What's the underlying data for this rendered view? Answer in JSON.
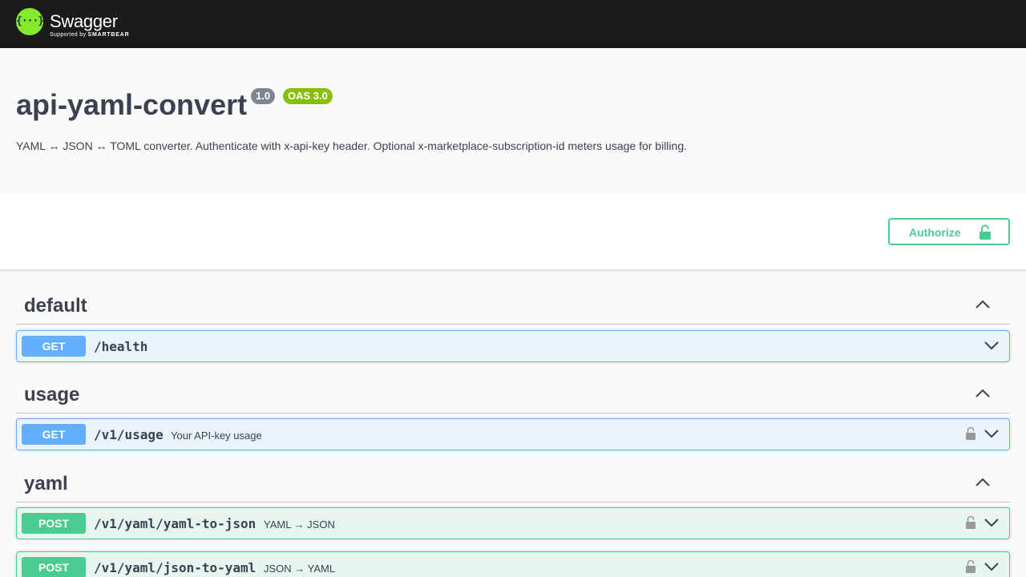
{
  "topbar": {
    "logo_glyph": "{···}",
    "logo_name": "Swagger",
    "logo_sub_prefix": "Supported by",
    "logo_sub_brand": "SMARTBEAR"
  },
  "info": {
    "title": "api-yaml-convert",
    "version": "1.0",
    "oas": "OAS 3.0",
    "description": "YAML ↔ JSON ↔ TOML converter. Authenticate with x-api-key header. Optional x-marketplace-subscription-id meters usage for billing."
  },
  "auth": {
    "label": "Authorize"
  },
  "tags": [
    {
      "name": "default"
    },
    {
      "name": "usage"
    },
    {
      "name": "yaml"
    }
  ],
  "ops": [
    {
      "method": "GET",
      "path": "/health",
      "summary": ""
    },
    {
      "method": "GET",
      "path": "/v1/usage",
      "summary": "Your API-key usage"
    },
    {
      "method": "POST",
      "path": "/v1/yaml/yaml-to-json",
      "summary": "YAML → JSON"
    },
    {
      "method": "POST",
      "path": "/v1/yaml/json-to-yaml",
      "summary": "JSON → YAML"
    }
  ],
  "colors": {
    "get": "#61affe",
    "post": "#49cc90",
    "brand": "#85ea2d",
    "topbar": "#1b1b1b"
  }
}
